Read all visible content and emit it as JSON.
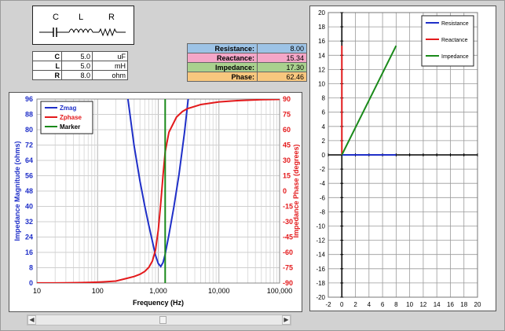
{
  "circuit": {
    "labels": [
      "C",
      "L",
      "R"
    ],
    "icon": "series-rlc-circuit-icon"
  },
  "inputs": [
    {
      "label": "C",
      "value": "5.0",
      "unit": "uF"
    },
    {
      "label": "L",
      "value": "5.0",
      "unit": "mH"
    },
    {
      "label": "R",
      "value": "8.0",
      "unit": "ohm"
    }
  ],
  "results": [
    {
      "label": "Resistance:",
      "value": "8.00",
      "color": "#9dc3e6"
    },
    {
      "label": "Reactance:",
      "value": "15.34",
      "color": "#f4a6c8"
    },
    {
      "label": "Impedance:",
      "value": "17.30",
      "color": "#a9d18e"
    },
    {
      "label": "Phase:",
      "value": "62.46",
      "color": "#f8c77e"
    }
  ],
  "scrollbar": {
    "left_arrow": "◀",
    "right_arrow": "▶",
    "position": 0.515
  },
  "chart_data": [
    {
      "type": "line",
      "x_scale": "log",
      "xlim": [
        10,
        100000
      ],
      "x_ticks": [
        "10",
        "100",
        "1,000",
        "10,000",
        "100,000"
      ],
      "xlabel": "Frequency (Hz)",
      "ylabel": "Impedance Magnitude (ohms)",
      "ylim": [
        0,
        96
      ],
      "y_ticks": [
        "0",
        "8",
        "16",
        "24",
        "32",
        "40",
        "48",
        "56",
        "64",
        "72",
        "80",
        "88",
        "96"
      ],
      "y2label": "Impedance Phase (degrees)",
      "y2lim": [
        -90,
        90
      ],
      "y2_ticks": [
        "-90",
        "-75",
        "-60",
        "-45",
        "-30",
        "-15",
        "0",
        "15",
        "30",
        "45",
        "60",
        "75",
        "90"
      ],
      "grid": true,
      "legend_position": "top-left",
      "series": [
        {
          "name": "Zmag",
          "color": "#1f2fc8",
          "axis": "left",
          "x": [
            300,
            400,
            500,
            600,
            700,
            800,
            900,
            1000,
            1100,
            1200,
            1300,
            1500,
            1800,
            2200,
            2700,
            3300,
            3500
          ],
          "y": [
            101.6,
            71.6,
            53.1,
            40.1,
            30.0,
            21.8,
            14.5,
            10.2,
            8.6,
            10.7,
            15.0,
            25.2,
            39.3,
            56.7,
            78.3,
            103.1,
            111.4
          ]
        },
        {
          "name": "Zphase",
          "color": "#e31a1c",
          "axis": "right",
          "x": [
            10,
            20,
            30,
            50,
            70,
            100,
            150,
            200,
            300,
            400,
            500,
            600,
            700,
            800,
            900,
            1000,
            1100,
            1200,
            1300,
            1500,
            2000,
            2500,
            3000,
            5000,
            10000,
            20000,
            50000,
            100000
          ],
          "y": [
            -89.9,
            -89.9,
            -89.8,
            -89.6,
            -89.4,
            -89.1,
            -88.6,
            -88.1,
            -85.5,
            -83.6,
            -81.4,
            -78.6,
            -74.6,
            -68.5,
            -57.8,
            -38.4,
            -11.8,
            15.7,
            38.2,
            57.6,
            72.4,
            77.8,
            80.5,
            84.6,
            87.2,
            88.5,
            89.4,
            89.7
          ]
        },
        {
          "name": "Marker",
          "color": "#1a8a1a",
          "axis": "left",
          "x": [
            1300,
            1300
          ],
          "y": [
            0,
            96
          ]
        }
      ]
    },
    {
      "type": "line",
      "xlim": [
        -2,
        20
      ],
      "ylim": [
        -20,
        20
      ],
      "x_ticks": [
        "-2",
        "0",
        "2",
        "4",
        "6",
        "8",
        "10",
        "12",
        "14",
        "16",
        "18",
        "20"
      ],
      "y_ticks": [
        "-20",
        "-18",
        "-16",
        "-14",
        "-12",
        "-10",
        "-8",
        "-6",
        "-4",
        "-2",
        "0",
        "2",
        "4",
        "6",
        "8",
        "10",
        "12",
        "14",
        "16",
        "18",
        "20"
      ],
      "grid": true,
      "legend_position": "top-right",
      "series": [
        {
          "name": "Resistance",
          "color": "#1f2fc8",
          "x": [
            0,
            8.0
          ],
          "y": [
            0,
            0
          ]
        },
        {
          "name": "Reactance",
          "color": "#e31a1c",
          "x": [
            0,
            0
          ],
          "y": [
            0,
            15.34
          ]
        },
        {
          "name": "Impedance",
          "color": "#1a8a1a",
          "x": [
            0,
            8.0
          ],
          "y": [
            0,
            15.34
          ]
        }
      ]
    }
  ]
}
